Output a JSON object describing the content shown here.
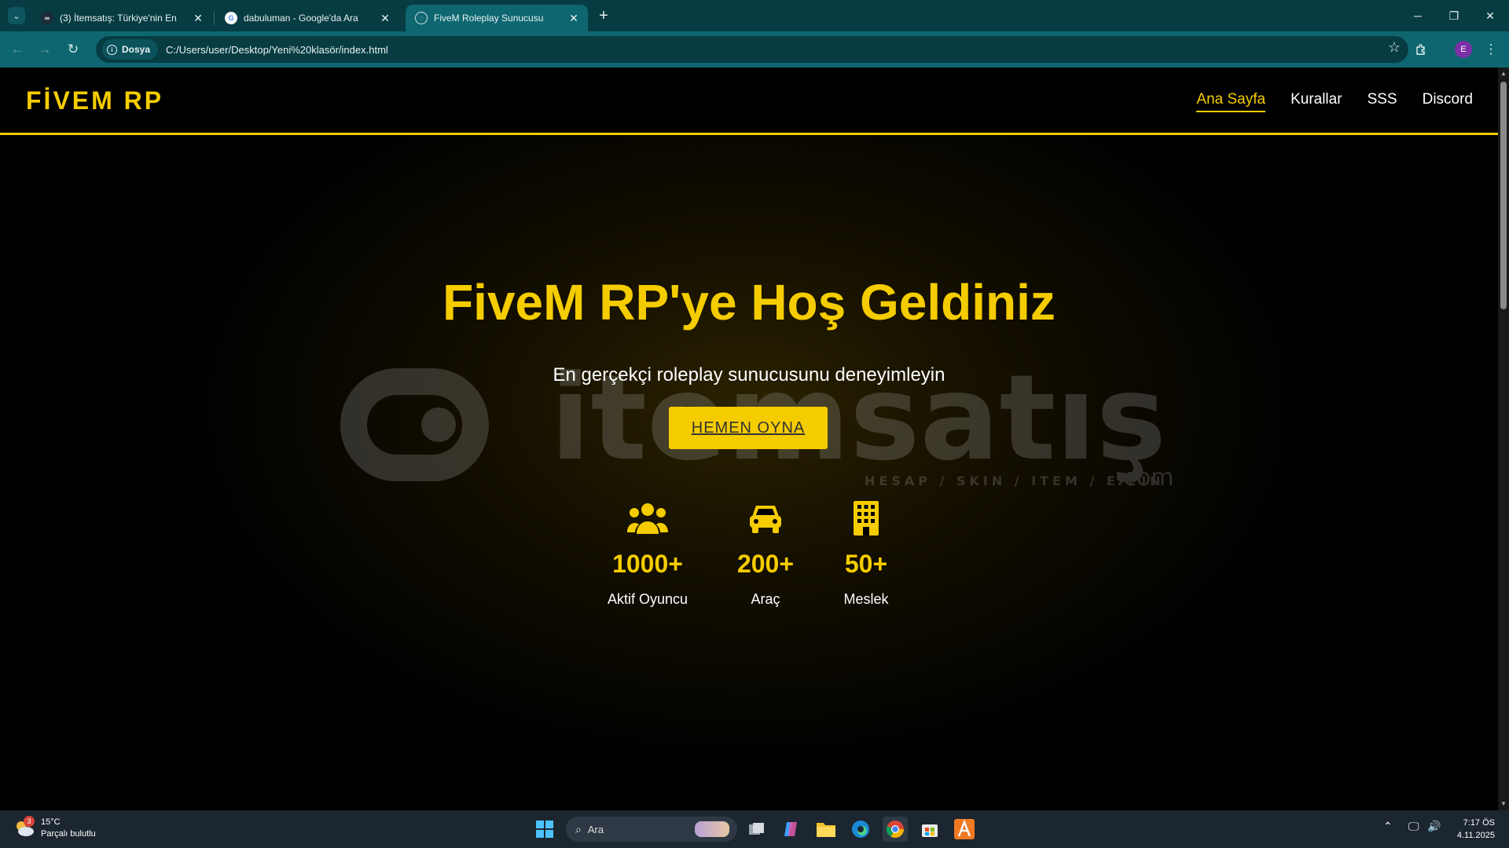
{
  "browser": {
    "tabs": [
      {
        "title": "(3) İtemsatış: Türkiye'nin En",
        "favicon": "itemsatis-icon",
        "active": false
      },
      {
        "title": "dabuluman - Google'da Ara",
        "favicon": "google-icon",
        "active": false
      },
      {
        "title": "FiveM Roleplay Sunucusu",
        "favicon": "globe-icon",
        "active": true
      }
    ],
    "address": {
      "chip": "Dosya",
      "url": "C:/Users/user/Desktop/Yeni%20klasör/index.html"
    },
    "profile_initial": "E"
  },
  "site": {
    "logo": "FİVEM RP",
    "nav": [
      "Ana Sayfa",
      "Kurallar",
      "SSS",
      "Discord"
    ],
    "active_nav": "Ana Sayfa",
    "hero": {
      "title": "FiveM RP'ye Hoş Geldiniz",
      "subtitle": "En gerçekçi roleplay sunucusunu deneyimleyin",
      "cta": "HEMEN OYNA"
    },
    "stats": [
      {
        "icon": "users-icon",
        "value": "1000+",
        "label": "Aktif Oyuncu"
      },
      {
        "icon": "car-icon",
        "value": "200+",
        "label": "Araç"
      },
      {
        "icon": "building-icon",
        "value": "50+",
        "label": "Meslek"
      }
    ]
  },
  "watermark": {
    "brand": "itemsatış",
    "tagline": "HESAP / SKIN / ITEM / E-PIN",
    "suffix": ".com"
  },
  "taskbar": {
    "weather": {
      "temp": "15°C",
      "condition": "Parçalı bulutlu",
      "badge": "3"
    },
    "search_placeholder": "Ara",
    "time": "7:17 ÖS",
    "date": "4.11.2025"
  },
  "colors": {
    "accent": "#f5cc00",
    "chrome_dark": "#073c43",
    "chrome_toolbar": "#0e6770",
    "page_bg": "#000000"
  }
}
